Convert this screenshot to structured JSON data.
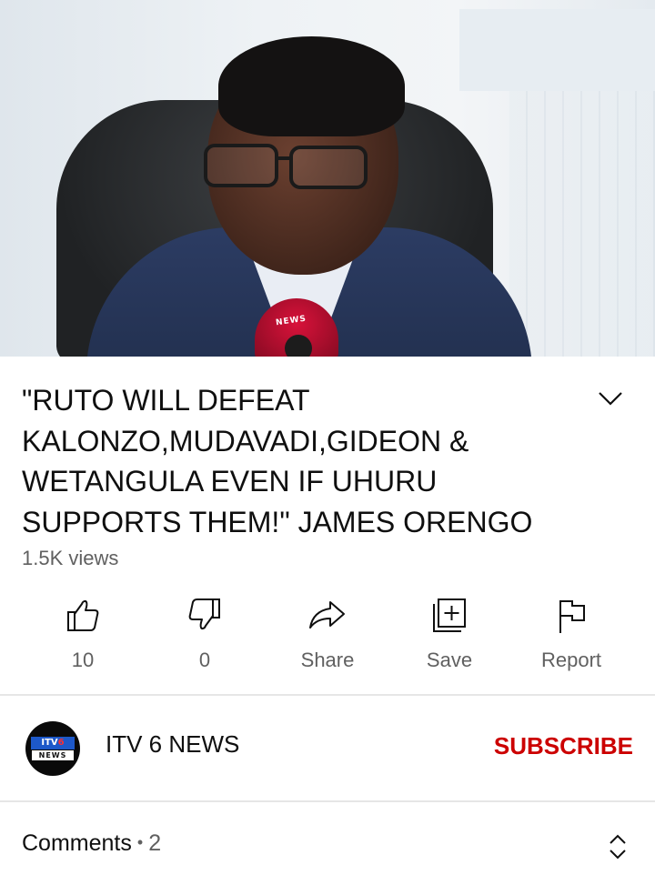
{
  "video": {
    "mic_label": "NEWS"
  },
  "title": "\"RUTO WILL DEFEAT KALONZO,MUDAVADI,GIDEON & WETANGULA EVEN IF UHURU SUPPORTS THEM!\" JAMES ORENGO",
  "views": "1.5K views",
  "actions": {
    "like": {
      "label": "10",
      "icon": "thumbs-up-icon"
    },
    "dislike": {
      "label": "0",
      "icon": "thumbs-down-icon"
    },
    "share": {
      "label": "Share",
      "icon": "share-arrow-icon"
    },
    "save": {
      "label": "Save",
      "icon": "add-to-playlist-icon"
    },
    "report": {
      "label": "Report",
      "icon": "flag-icon"
    }
  },
  "channel": {
    "name": "ITV 6 NEWS",
    "avatar_text_top_a": "ITV",
    "avatar_text_top_b": "6",
    "avatar_text_bottom": "NEWS",
    "subscribe_label": "SUBSCRIBE"
  },
  "comments": {
    "label": "Comments",
    "separator": "•",
    "count": "2"
  },
  "colors": {
    "subscribe": "#cc0000",
    "secondary_text": "#606060",
    "divider": "#e6e6e6"
  }
}
